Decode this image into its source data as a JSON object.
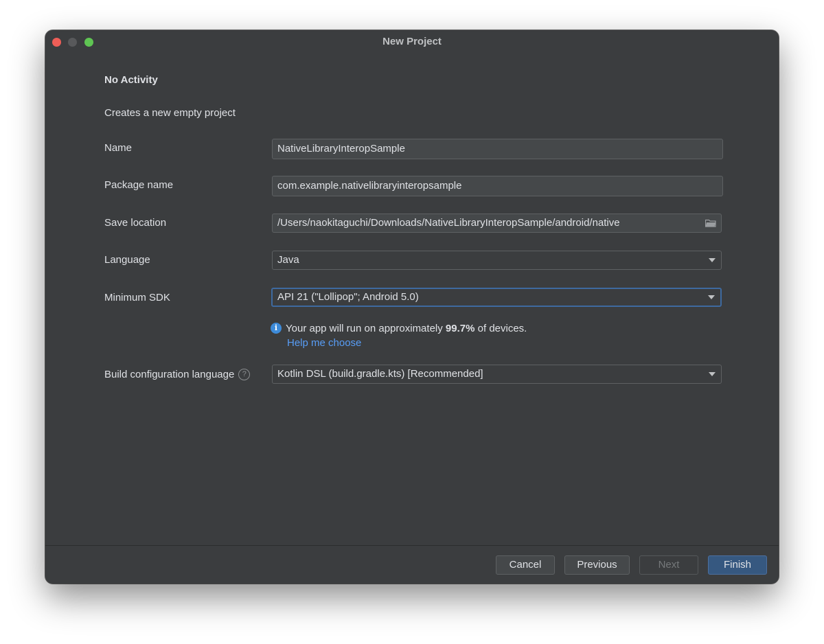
{
  "window": {
    "title": "New Project"
  },
  "template": {
    "heading": "No Activity",
    "description": "Creates a new empty project"
  },
  "form": {
    "name": {
      "label": "Name",
      "value": "NativeLibraryInteropSample"
    },
    "package": {
      "label": "Package name",
      "value": "com.example.nativelibraryinteropsample"
    },
    "save_location": {
      "label": "Save location",
      "value": "/Users/naokitaguchi/Downloads/NativeLibraryInteropSample/android/native",
      "icon": "folder-icon"
    },
    "language": {
      "label": "Language",
      "value": "Java"
    },
    "min_sdk": {
      "label": "Minimum SDK",
      "value": "API 21 (\"Lollipop\"; Android 5.0)"
    },
    "info": {
      "prefix": "Your app will run on approximately ",
      "percent": "99.7%",
      "suffix": " of devices.",
      "help_link": "Help me choose"
    },
    "build_config": {
      "label": "Build configuration language",
      "value": "Kotlin DSL (build.gradle.kts) [Recommended]"
    }
  },
  "buttons": {
    "cancel": "Cancel",
    "previous": "Previous",
    "next": "Next",
    "finish": "Finish"
  },
  "colors": {
    "accent": "#3e6aa0",
    "link": "#589df6",
    "primary_button": "#365880"
  }
}
